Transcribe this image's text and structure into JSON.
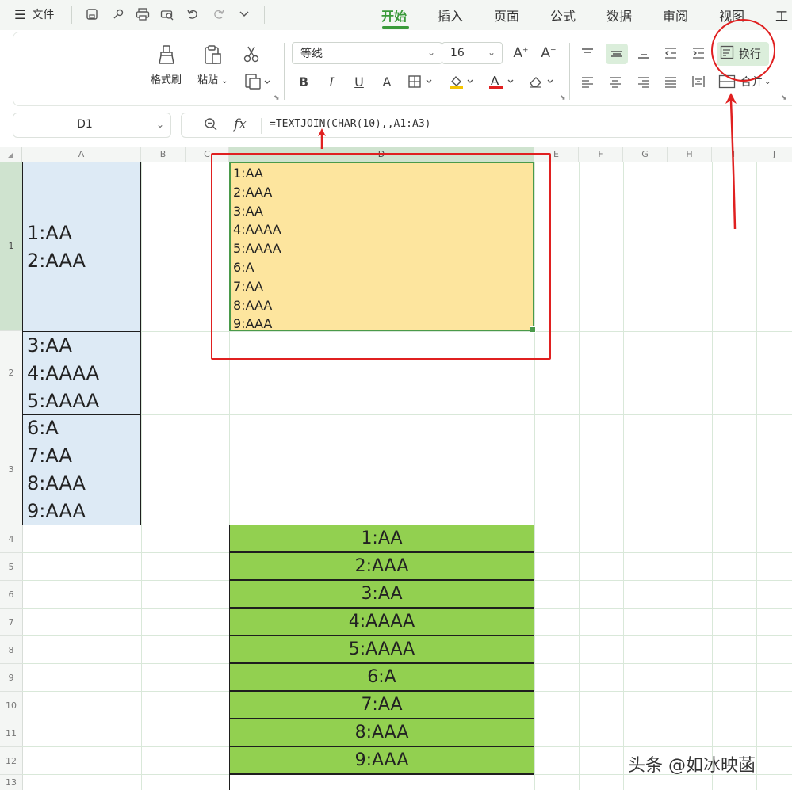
{
  "menu": {
    "file_label": "文件",
    "tabs": [
      {
        "label": "开始",
        "active": true
      },
      {
        "label": "插入",
        "active": false
      },
      {
        "label": "页面",
        "active": false
      },
      {
        "label": "公式",
        "active": false
      },
      {
        "label": "数据",
        "active": false
      },
      {
        "label": "审阅",
        "active": false
      },
      {
        "label": "视图",
        "active": false
      },
      {
        "label": "工",
        "active": false
      }
    ],
    "accent_color": "#3a9a3a"
  },
  "ribbon": {
    "format_painter_label": "格式刷",
    "paste_label": "粘贴",
    "font_name": "等线",
    "font_size": "16",
    "wrap_label": "换行",
    "merge_label": "合并"
  },
  "formula_bar": {
    "name_box": "D1",
    "fx_label": "fx",
    "formula": "=TEXTJOIN(CHAR(10),,A1:A3)"
  },
  "columns": [
    "A",
    "B",
    "C",
    "D",
    "E",
    "F",
    "G",
    "H",
    "I",
    "J"
  ],
  "rows": [
    "1",
    "2",
    "3",
    "4",
    "5",
    "6",
    "7",
    "8",
    "9",
    "10",
    "11",
    "12",
    "13"
  ],
  "cells": {
    "A1": [
      "1:AA",
      "2:AAA"
    ],
    "A2": [
      "3:AA",
      "4:AAAA",
      "5:AAAA"
    ],
    "A3": [
      "6:A",
      "7:AA",
      "8:AAA",
      "9:AAA"
    ],
    "D1": [
      "1:AA",
      "2:AAA",
      "3:AA",
      "4:AAAA",
      "5:AAAA",
      "6:A",
      "7:AA",
      "8:AAA",
      "9:AAA"
    ],
    "D4_D12": [
      "1:AA",
      "2:AAA",
      "3:AA",
      "4:AAAA",
      "5:AAAA",
      "6:A",
      "7:AA",
      "8:AAA",
      "9:AAA"
    ]
  },
  "colors": {
    "cell_a_fill": "#ddeaf5",
    "cell_d1_fill": "#fde59e",
    "green_fill": "#92d050",
    "annotation_red": "#e02020"
  },
  "watermark": "头条 @如冰映菡"
}
